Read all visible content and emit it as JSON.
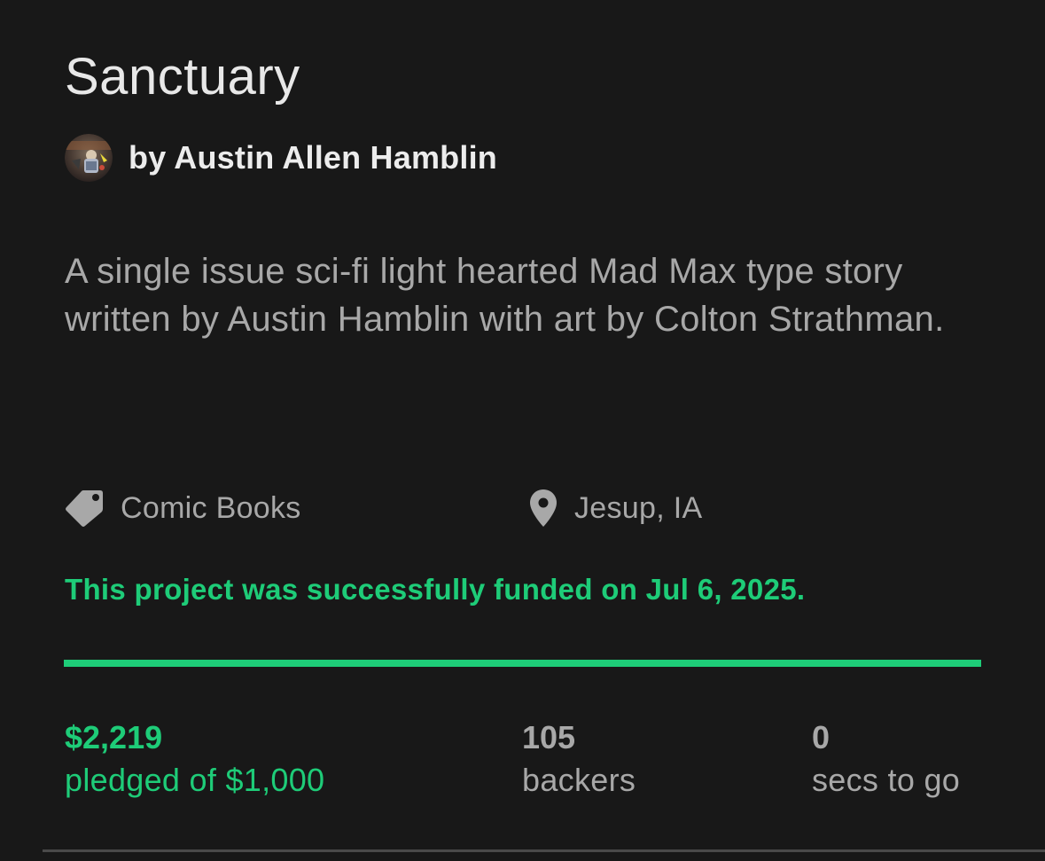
{
  "project": {
    "title": "Sanctuary",
    "creator": "by Austin Allen Hamblin",
    "blurb": "A single issue sci-fi light hearted Mad Max type story written by Austin Hamblin with art by Colton Strathman.",
    "category": "Comic Books",
    "location": "Jesup, IA",
    "category_icon": "tag-icon",
    "location_icon": "map-pin-icon",
    "funded_message": "This project was successfully funded on Jul 6, 2025.",
    "progress_percent": 100
  },
  "stats": {
    "pledged_amount": "$2,219",
    "pledged_label": "pledged of $1,000",
    "backers_count": "105",
    "backers_label": "backers",
    "time_value": "0",
    "time_label": "secs to go"
  },
  "colors": {
    "background": "#181818",
    "success_green": "#1ecc78",
    "muted_text": "#a8a8a8",
    "primary_text": "#e8e8e8"
  }
}
